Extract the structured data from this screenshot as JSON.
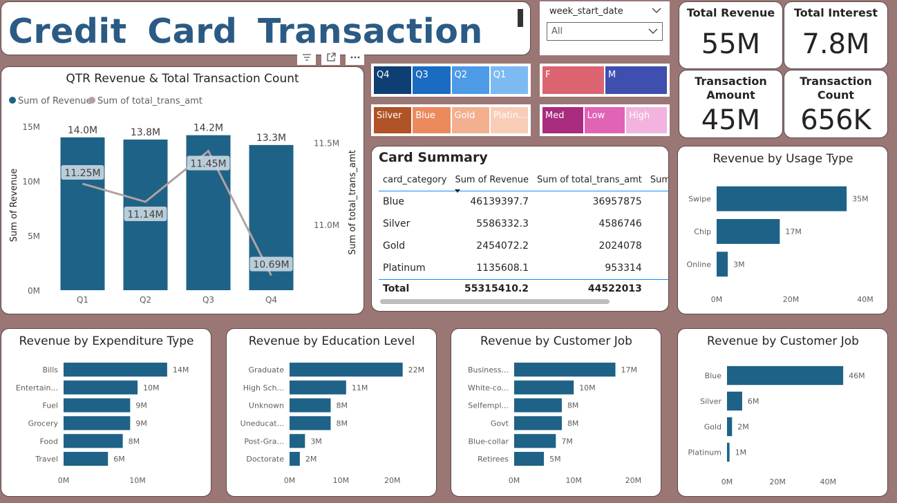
{
  "header": {
    "title": "Credit  Card  Transaction"
  },
  "toolbar": {
    "filter_icon": "filter-icon",
    "focus_icon": "focus-mode-icon",
    "more_icon": "more-options-icon"
  },
  "filter": {
    "label": "week_start_date",
    "value": "All"
  },
  "kpis": [
    {
      "label": "Total Revenue",
      "value": "55M"
    },
    {
      "label": "Total Interest",
      "value": "7.8M"
    },
    {
      "label": "Transaction Amount",
      "value": "45M"
    },
    {
      "label": "Transaction Count",
      "value": "656K"
    }
  ],
  "slicers": {
    "quarter": [
      {
        "label": "Q4",
        "color": "#0e3f73"
      },
      {
        "label": "Q3",
        "color": "#1a6cc2"
      },
      {
        "label": "Q2",
        "color": "#4d9ae6"
      },
      {
        "label": "Q1",
        "color": "#7dbaf2"
      }
    ],
    "gender": [
      {
        "label": "F",
        "color": "#dc6470"
      },
      {
        "label": "M",
        "color": "#3f4fb0"
      }
    ],
    "card": [
      {
        "label": "Silver",
        "color": "#b05227"
      },
      {
        "label": "Blue",
        "color": "#ec8a5e"
      },
      {
        "label": "Gold",
        "color": "#f2b08f"
      },
      {
        "label": "Platin...",
        "color": "#f8ccb6"
      }
    ],
    "income": [
      {
        "label": "Med",
        "color": "#a82b7d"
      },
      {
        "label": "Low",
        "color": "#e063b5"
      },
      {
        "label": "High",
        "color": "#f2b3df"
      }
    ]
  },
  "card_summary": {
    "title": "Card Summary",
    "columns": [
      "card_category",
      "Sum of Revenue",
      "Sum of total_trans_amt",
      "Sum of in"
    ],
    "rows": [
      [
        "Blue",
        "46139397.7",
        "36957875"
      ],
      [
        "Silver",
        "5586332.3",
        "4586746"
      ],
      [
        "Gold",
        "2454072.2",
        "2024078"
      ],
      [
        "Platinum",
        "1135608.1",
        "953314"
      ]
    ],
    "total": [
      "Total",
      "55315410.2",
      "44522013"
    ]
  },
  "chart_data": [
    {
      "type": "bar",
      "title": "QTR Revenue & Total Transaction Count",
      "legend": [
        "Sum of Revenue",
        "Sum of total_trans_amt"
      ],
      "legend_colors": [
        "#1f6287",
        "#b1a2a2"
      ],
      "legend_position": "top-left",
      "categories": [
        "Q1",
        "Q2",
        "Q3",
        "Q4"
      ],
      "series": [
        {
          "name": "Sum of Revenue",
          "type": "bar",
          "values": [
            14.0,
            13.8,
            14.2,
            13.3
          ],
          "labels": [
            "14.0M",
            "13.8M",
            "14.2M",
            "13.3M"
          ]
        },
        {
          "name": "Sum of total_trans_amt",
          "type": "line",
          "values": [
            11.25,
            11.14,
            11.45,
            10.69
          ],
          "labels": [
            "11.25M",
            "11.14M",
            "11.45M",
            "10.69M"
          ]
        }
      ],
      "ylabel": "Sum of Revenue",
      "ylim": [
        0,
        15
      ],
      "yticks": [
        "0M",
        "5M",
        "10M",
        "15M"
      ],
      "y2label": "Sum of total_trans_amt",
      "y2lim": [
        10.6,
        11.6
      ],
      "y2ticks": [
        "11.0M",
        "11.5M"
      ]
    },
    {
      "type": "bar",
      "orientation": "horizontal",
      "title": "Revenue by Usage Type",
      "categories": [
        "Swipe",
        "Chip",
        "Online"
      ],
      "values": [
        35,
        17,
        3
      ],
      "labels": [
        "35M",
        "17M",
        "3M"
      ],
      "xlim": [
        0,
        40
      ],
      "xticks": [
        "0M",
        "20M",
        "40M"
      ]
    },
    {
      "type": "bar",
      "orientation": "horizontal",
      "title": "Revenue by Expenditure Type",
      "categories": [
        "Bills",
        "Entertain...",
        "Fuel",
        "Grocery",
        "Food",
        "Travel"
      ],
      "values": [
        14,
        10,
        9,
        9,
        8,
        6
      ],
      "labels": [
        "14M",
        "10M",
        "9M",
        "9M",
        "8M",
        "6M"
      ],
      "xlim": [
        0,
        17
      ],
      "xticks": [
        "0M",
        "10M"
      ]
    },
    {
      "type": "bar",
      "orientation": "horizontal",
      "title": "Revenue by Education Level",
      "categories": [
        "Graduate",
        "High Sch...",
        "Unknown",
        "Uneducat...",
        "Post-Gra...",
        "Doctorate"
      ],
      "values": [
        22,
        11,
        8,
        8,
        3,
        2
      ],
      "labels": [
        "22M",
        "11M",
        "8M",
        "8M",
        "3M",
        "2M"
      ],
      "xlim": [
        0,
        25
      ],
      "xticks": [
        "0M",
        "10M",
        "20M"
      ]
    },
    {
      "type": "bar",
      "orientation": "horizontal",
      "title": "Revenue by Customer Job",
      "categories": [
        "Business...",
        "White-co...",
        "Selfempl...",
        "Govt",
        "Blue-collar",
        "Retirees"
      ],
      "values": [
        17,
        10,
        8,
        8,
        7,
        5
      ],
      "labels": [
        "17M",
        "10M",
        "8M",
        "8M",
        "7M",
        "5M"
      ],
      "xlim": [
        0,
        21
      ],
      "xticks": [
        "0M",
        "10M",
        "20M"
      ]
    },
    {
      "type": "bar",
      "orientation": "horizontal",
      "title": "Revenue by Customer Job",
      "categories": [
        "Blue",
        "Silver",
        "Gold",
        "Platinum"
      ],
      "values": [
        46,
        6,
        2,
        1
      ],
      "labels": [
        "46M",
        "6M",
        "2M",
        "1M"
      ],
      "xlim": [
        0,
        58
      ],
      "xticks": [
        "0M",
        "20M",
        "40M"
      ]
    }
  ]
}
